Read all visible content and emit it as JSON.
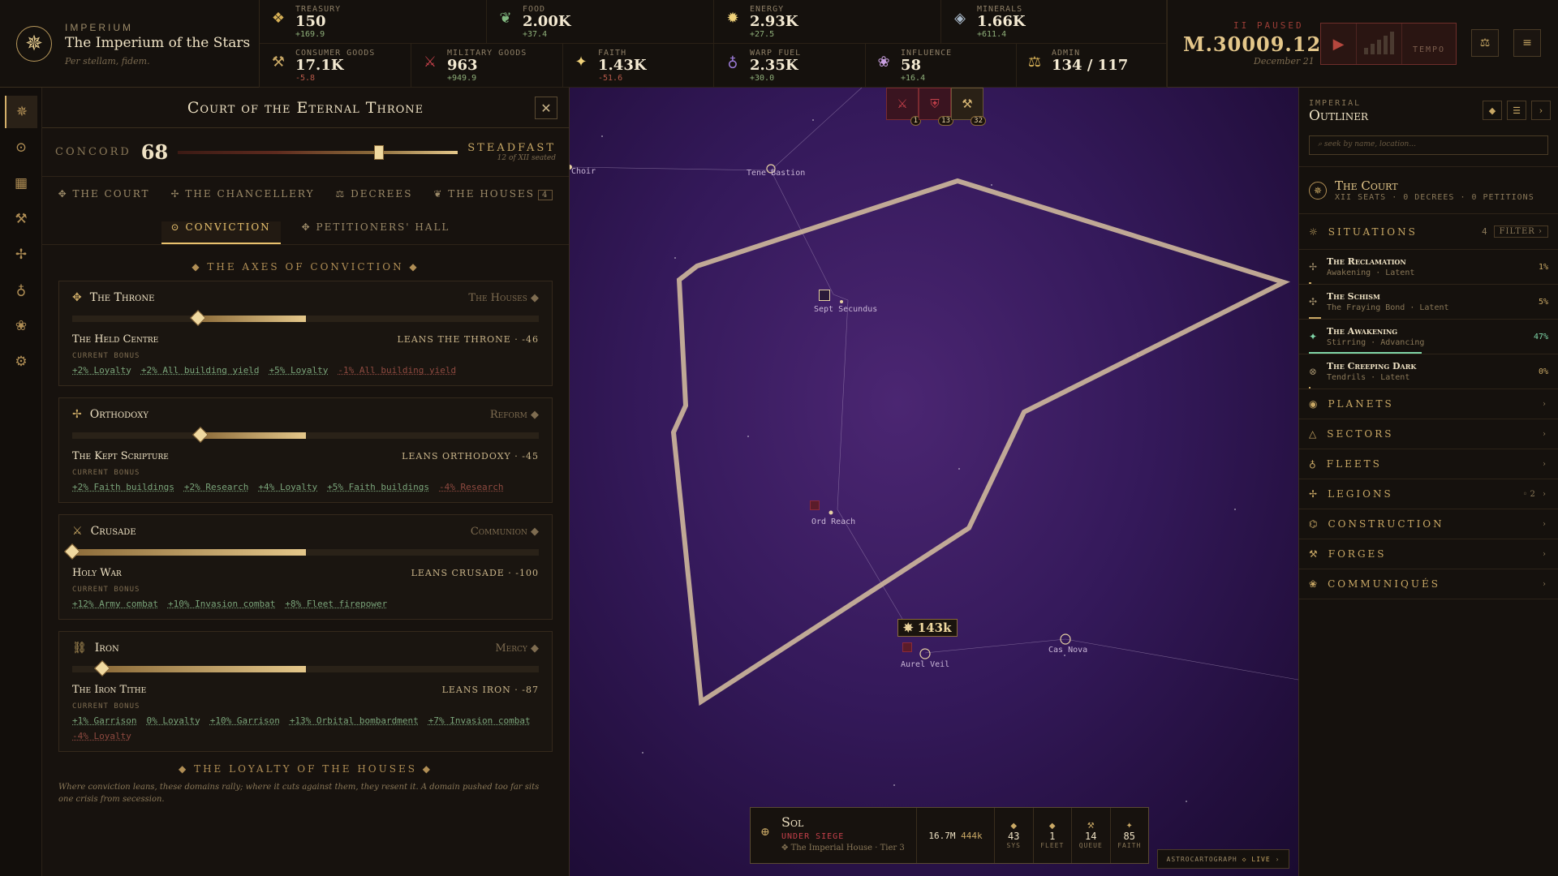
{
  "brand": {
    "kicker": "IMPERIUM",
    "title": "The Imperium of the Stars",
    "motto": "Per stellam, fidem."
  },
  "resources_top": [
    {
      "label": "TREASURY",
      "value": "150",
      "delta": "+169.9",
      "icon": "coin-icon",
      "glyph": "❖",
      "color": "#d6b056"
    },
    {
      "label": "FOOD",
      "value": "2.00K",
      "delta": "+37.4",
      "icon": "food-icon",
      "glyph": "❦",
      "color": "#7fb77f"
    },
    {
      "label": "ENERGY",
      "value": "2.93K",
      "delta": "+27.5",
      "icon": "energy-icon",
      "glyph": "✹",
      "color": "#f0d27a"
    },
    {
      "label": "MINERALS",
      "value": "1.66K",
      "delta": "+611.4",
      "icon": "minerals-icon",
      "glyph": "◈",
      "color": "#a8b8c8"
    }
  ],
  "resources_bottom": [
    {
      "label": "CONSUMER GOODS",
      "value": "17.1K",
      "delta": "-5.8",
      "neg": true,
      "icon": "hammer-icon",
      "glyph": "⚒",
      "color": "#c9a865"
    },
    {
      "label": "MILITARY GOODS",
      "value": "963",
      "delta": "+949.9",
      "icon": "swords-icon",
      "glyph": "⚔",
      "color": "#c5404a"
    },
    {
      "label": "FAITH",
      "value": "1.43K",
      "delta": "-51.6",
      "neg": true,
      "icon": "faith-icon",
      "glyph": "✦",
      "color": "#f0d27a"
    },
    {
      "label": "WARP FUEL",
      "value": "2.35K",
      "delta": "+30.0",
      "icon": "warp-fuel-icon",
      "glyph": "♁",
      "color": "#9a7ad6"
    },
    {
      "label": "INFLUENCE",
      "value": "58",
      "delta": "+16.4",
      "icon": "influence-icon",
      "glyph": "❀",
      "color": "#c9a0e0"
    },
    {
      "label": "ADMIN",
      "value": "134 / 117",
      "delta": "",
      "icon": "scales-icon",
      "glyph": "⚖",
      "color": "#d6b056"
    }
  ],
  "clock": {
    "paused": "II PAUSED",
    "date": "M.30009.12",
    "sub": "December 21",
    "tempo": "TEMPO"
  },
  "court": {
    "title": "Court of the Eternal Throne",
    "concord_label": "CONCORD",
    "concord_value": "68",
    "concord_level": 0.68,
    "steadfast": "STEADFAST",
    "seated": "12 of XII seated",
    "tabs": [
      "THE COURT",
      "THE CHANCELLERY",
      "DECREES",
      "THE HOUSES"
    ],
    "houses_count": "4",
    "tabs2": [
      "CONVICTION",
      "PETITIONERS' HALL"
    ],
    "axes_heading": "THE AXES OF CONVICTION",
    "axes": [
      {
        "name": "The Throne",
        "opp": "The Houses",
        "held": "The Held Centre",
        "lean": "LEANS THE THRONE · -46",
        "level": -0.46,
        "bonus_label": "CURRENT BONUS",
        "bonuses": [
          {
            "t": "+2% Loyalty"
          },
          {
            "t": "+2% All building yield"
          },
          {
            "t": "+5% Loyalty"
          },
          {
            "t": "-1% All building yield",
            "neg": true
          }
        ]
      },
      {
        "name": "Orthodoxy",
        "opp": "Reform",
        "held": "The Kept Scripture",
        "lean": "LEANS ORTHODOXY · -45",
        "level": -0.45,
        "bonus_label": "CURRENT BONUS",
        "bonuses": [
          {
            "t": "+2% Faith buildings"
          },
          {
            "t": "+2% Research"
          },
          {
            "t": "+4% Loyalty"
          },
          {
            "t": "+5% Faith buildings"
          },
          {
            "t": "-4% Research",
            "neg": true
          }
        ]
      },
      {
        "name": "Crusade",
        "opp": "Communion",
        "held": "Holy War",
        "lean": "LEANS CRUSADE · -100",
        "level": -1.0,
        "bonus_label": "CURRENT BONUS",
        "bonuses": [
          {
            "t": "+12% Army combat"
          },
          {
            "t": "+10% Invasion combat"
          },
          {
            "t": "+8% Fleet firepower"
          }
        ]
      },
      {
        "name": "Iron",
        "opp": "Mercy",
        "held": "The Iron Tithe",
        "lean": "LEANS IRON · -87",
        "level": -0.87,
        "bonus_label": "CURRENT BONUS",
        "bonuses": [
          {
            "t": "+1% Garrison"
          },
          {
            "t": "0% Loyalty"
          },
          {
            "t": "+10% Garrison"
          },
          {
            "t": "+13% Orbital bombardment"
          },
          {
            "t": "+7% Invasion combat"
          },
          {
            "t": "-4% Loyalty",
            "neg": true
          }
        ]
      }
    ],
    "loyalty_heading": "THE LOYALTY OF THE HOUSES",
    "loyalty_text": "Where conviction leans, these domains rally; where it cuts against them, they resent it. A domain pushed too far sits one crisis from secession."
  },
  "map": {
    "labels": [
      "Choir",
      "Tene Bastion",
      "Sept Secundus",
      "Ord Reach",
      "Aurel Veil",
      "Cas Nova"
    ],
    "fleet_strength": "143k",
    "top_badges": [
      "1",
      "13",
      "32"
    ]
  },
  "sol": {
    "name": "Sol",
    "status": "UNDER SIEGE",
    "house": "The Imperial House · Tier 3",
    "pop_a": "16.7M",
    "pop_b": "444k",
    "stats": [
      {
        "v": "43",
        "l": "SYS"
      },
      {
        "v": "1",
        "l": "FLEET"
      },
      {
        "v": "14",
        "l": "QUEUE"
      },
      {
        "v": "85",
        "l": "FAITH"
      }
    ]
  },
  "astro": {
    "label": "ASTROCARTOGRAPH",
    "live": "LIVE"
  },
  "outliner": {
    "kicker": "IMPERIAL",
    "title": "Outliner",
    "search_placeholder": "seek by name, location...",
    "court_title": "The Court",
    "court_sub": "XII SEATS · 0 DECREES · 0 PETITIONS",
    "situations_label": "SITUATIONS",
    "situations_count": "4",
    "filter": "FILTER",
    "situations": [
      {
        "name": "The Reclamation",
        "sub": "Awakening · Latent",
        "pct": "1%",
        "progress": 0.01,
        "icon": "✢"
      },
      {
        "name": "The Schism",
        "sub": "The Fraying Bond · Latent",
        "pct": "5%",
        "progress": 0.05,
        "icon": "✣"
      },
      {
        "name": "The Awakening",
        "sub": "Stirring · Advancing",
        "pct": "47%",
        "progress": 0.47,
        "icon": "✦",
        "accent": "#7fd6a8"
      },
      {
        "name": "The Creeping Dark",
        "sub": "Tendrils · Latent",
        "pct": "0%",
        "progress": 0.0,
        "icon": "⊗"
      }
    ],
    "sections": [
      {
        "label": "PLANETS",
        "icon": "◉"
      },
      {
        "label": "SECTORS",
        "icon": "△"
      },
      {
        "label": "FLEETS",
        "icon": "♁"
      },
      {
        "label": "LEGIONS",
        "icon": "✢",
        "badge": "2"
      },
      {
        "label": "CONSTRUCTION",
        "icon": "⌬"
      },
      {
        "label": "FORGES",
        "icon": "⚒"
      },
      {
        "label": "COMMUNIQUÉS",
        "icon": "❀"
      }
    ]
  }
}
